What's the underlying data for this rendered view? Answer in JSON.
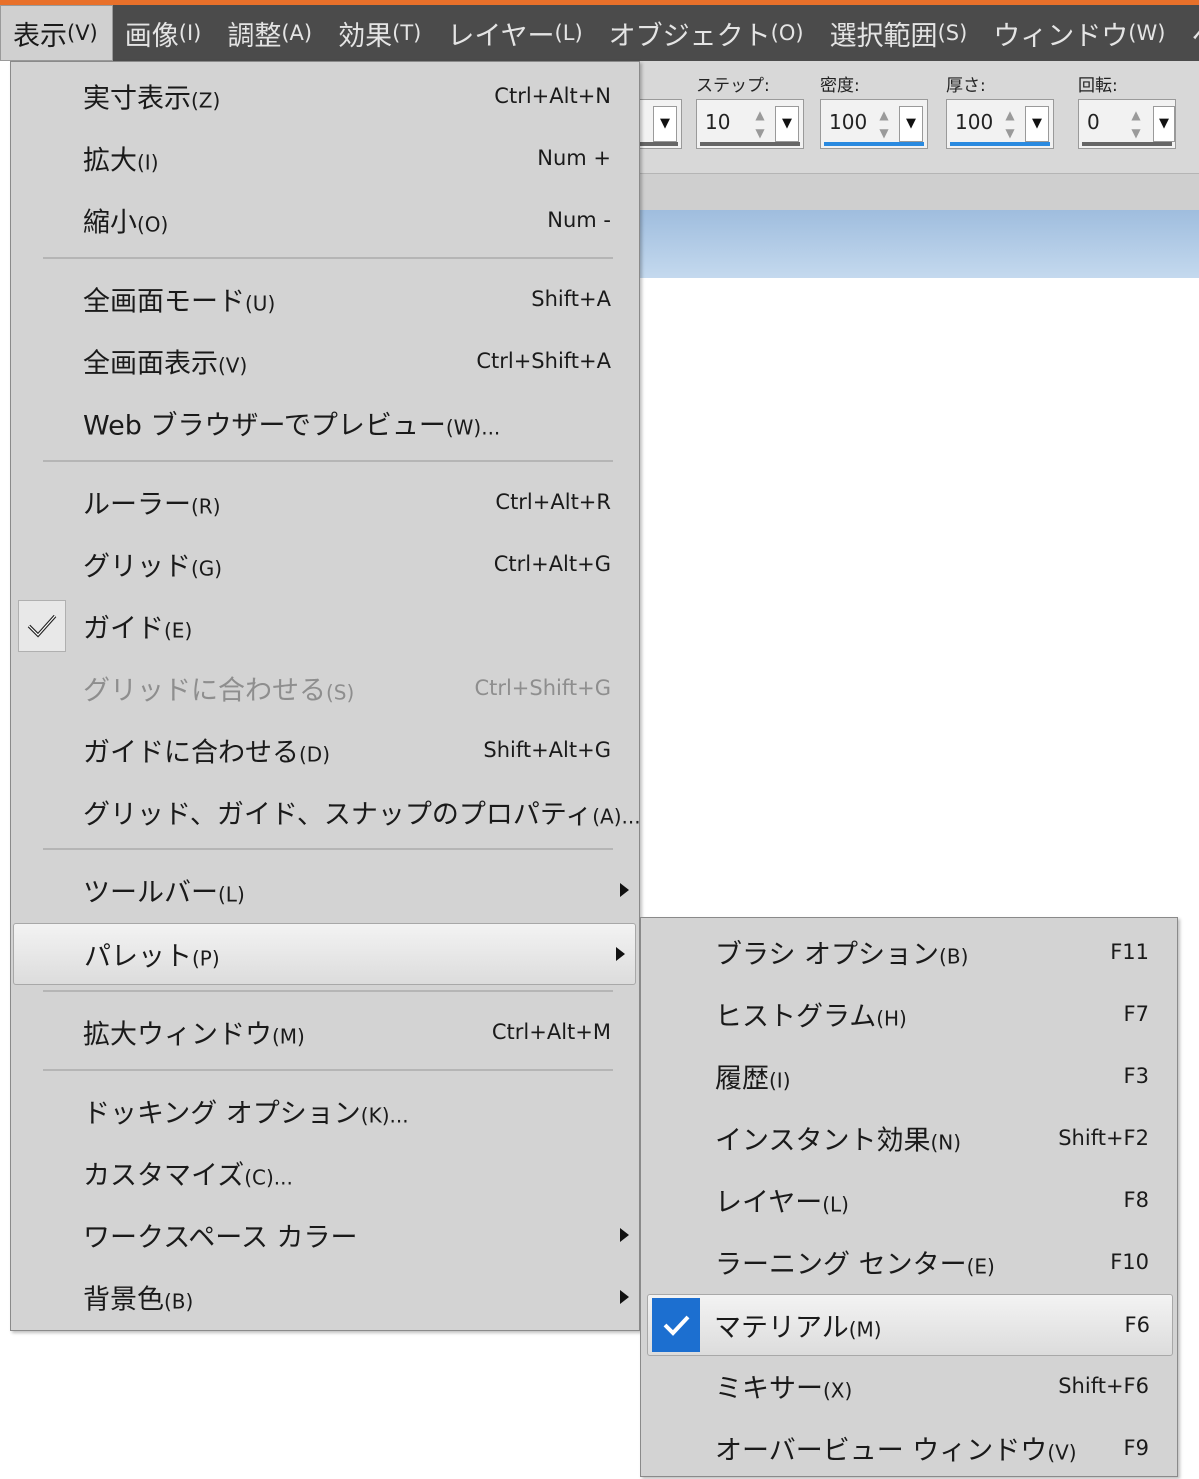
{
  "menubar": {
    "items": [
      {
        "label": "表示",
        "accel": "(V)",
        "active": true
      },
      {
        "label": "画像",
        "accel": "(I)"
      },
      {
        "label": "調整",
        "accel": "(A)"
      },
      {
        "label": "効果",
        "accel": "(T)"
      },
      {
        "label": "レイヤー",
        "accel": "(L)"
      },
      {
        "label": "オブジェクト",
        "accel": "(O)"
      },
      {
        "label": "選択範囲",
        "accel": "(S)"
      },
      {
        "label": "ウィンドウ",
        "accel": "(W)"
      },
      {
        "label": "ヘ",
        "accel": ""
      }
    ]
  },
  "toolbar": {
    "step_label": "ステップ:",
    "step_value": "10",
    "density_label": "密度:",
    "density_value": "100",
    "thickness_label": "厚さ:",
    "thickness_value": "100",
    "rotation_label": "回転:",
    "rotation_value": "0"
  },
  "view_menu": {
    "items": [
      {
        "label": "実寸表示",
        "accel": "(Z)",
        "shortcut": "Ctrl+Alt+N"
      },
      {
        "label": "拡大",
        "accel": "(I)",
        "shortcut": "Num +"
      },
      {
        "label": "縮小",
        "accel": "(O)",
        "shortcut": "Num -"
      },
      {
        "label": "全画面モード",
        "accel": "(U)",
        "shortcut": "Shift+A"
      },
      {
        "label": "全画面表示",
        "accel": "(V)",
        "shortcut": "Ctrl+Shift+A"
      },
      {
        "label": "Web ブラウザーでプレビュー",
        "accel": "(W)...",
        "shortcut": ""
      },
      {
        "label": "ルーラー",
        "accel": "(R)",
        "shortcut": "Ctrl+Alt+R"
      },
      {
        "label": "グリッド",
        "accel": "(G)",
        "shortcut": "Ctrl+Alt+G"
      },
      {
        "label": "ガイド",
        "accel": "(E)",
        "shortcut": "",
        "checked": true
      },
      {
        "label": "グリッドに合わせる",
        "accel": "(S)",
        "shortcut": "Ctrl+Shift+G",
        "disabled": true
      },
      {
        "label": "ガイドに合わせる",
        "accel": "(D)",
        "shortcut": "Shift+Alt+G"
      },
      {
        "label": "グリッド、ガイド、スナップのプロパティ",
        "accel": "(A)...",
        "shortcut": ""
      },
      {
        "label": "ツールバー",
        "accel": "(L)",
        "shortcut": "",
        "submenu": true
      },
      {
        "label": "パレット",
        "accel": "(P)",
        "shortcut": "",
        "submenu": true,
        "highlighted": true
      },
      {
        "label": "拡大ウィンドウ",
        "accel": "(M)",
        "shortcut": "Ctrl+Alt+M"
      },
      {
        "label": "ドッキング オプション",
        "accel": "(K)...",
        "shortcut": ""
      },
      {
        "label": "カスタマイズ",
        "accel": "(C)...",
        "shortcut": ""
      },
      {
        "label": "ワークスペース カラー",
        "accel": "",
        "shortcut": "",
        "submenu": true
      },
      {
        "label": "背景色",
        "accel": "(B)",
        "shortcut": "",
        "submenu": true
      }
    ]
  },
  "palette_submenu": {
    "items": [
      {
        "label": "ブラシ オプション",
        "accel": "(B)",
        "shortcut": "F11"
      },
      {
        "label": "ヒストグラム",
        "accel": "(H)",
        "shortcut": "F7"
      },
      {
        "label": "履歴",
        "accel": "(I)",
        "shortcut": "F3"
      },
      {
        "label": "インスタント効果",
        "accel": "(N)",
        "shortcut": "Shift+F2"
      },
      {
        "label": "レイヤー",
        "accel": "(L)",
        "shortcut": "F8"
      },
      {
        "label": "ラーニング センター",
        "accel": "(E)",
        "shortcut": "F10"
      },
      {
        "label": "マテリアル",
        "accel": "(M)",
        "shortcut": "F6",
        "checked": true,
        "highlighted": true
      },
      {
        "label": "ミキサー",
        "accel": "(X)",
        "shortcut": "Shift+F6"
      },
      {
        "label": "オーバービュー ウィンドウ",
        "accel": "(V)",
        "shortcut": "F9"
      }
    ]
  },
  "colors": {
    "accent_orange": "#e8702a",
    "menubar_bg": "#4b4b4b",
    "menu_bg": "#d3d3d3",
    "check_blue": "#1c6fd0"
  }
}
